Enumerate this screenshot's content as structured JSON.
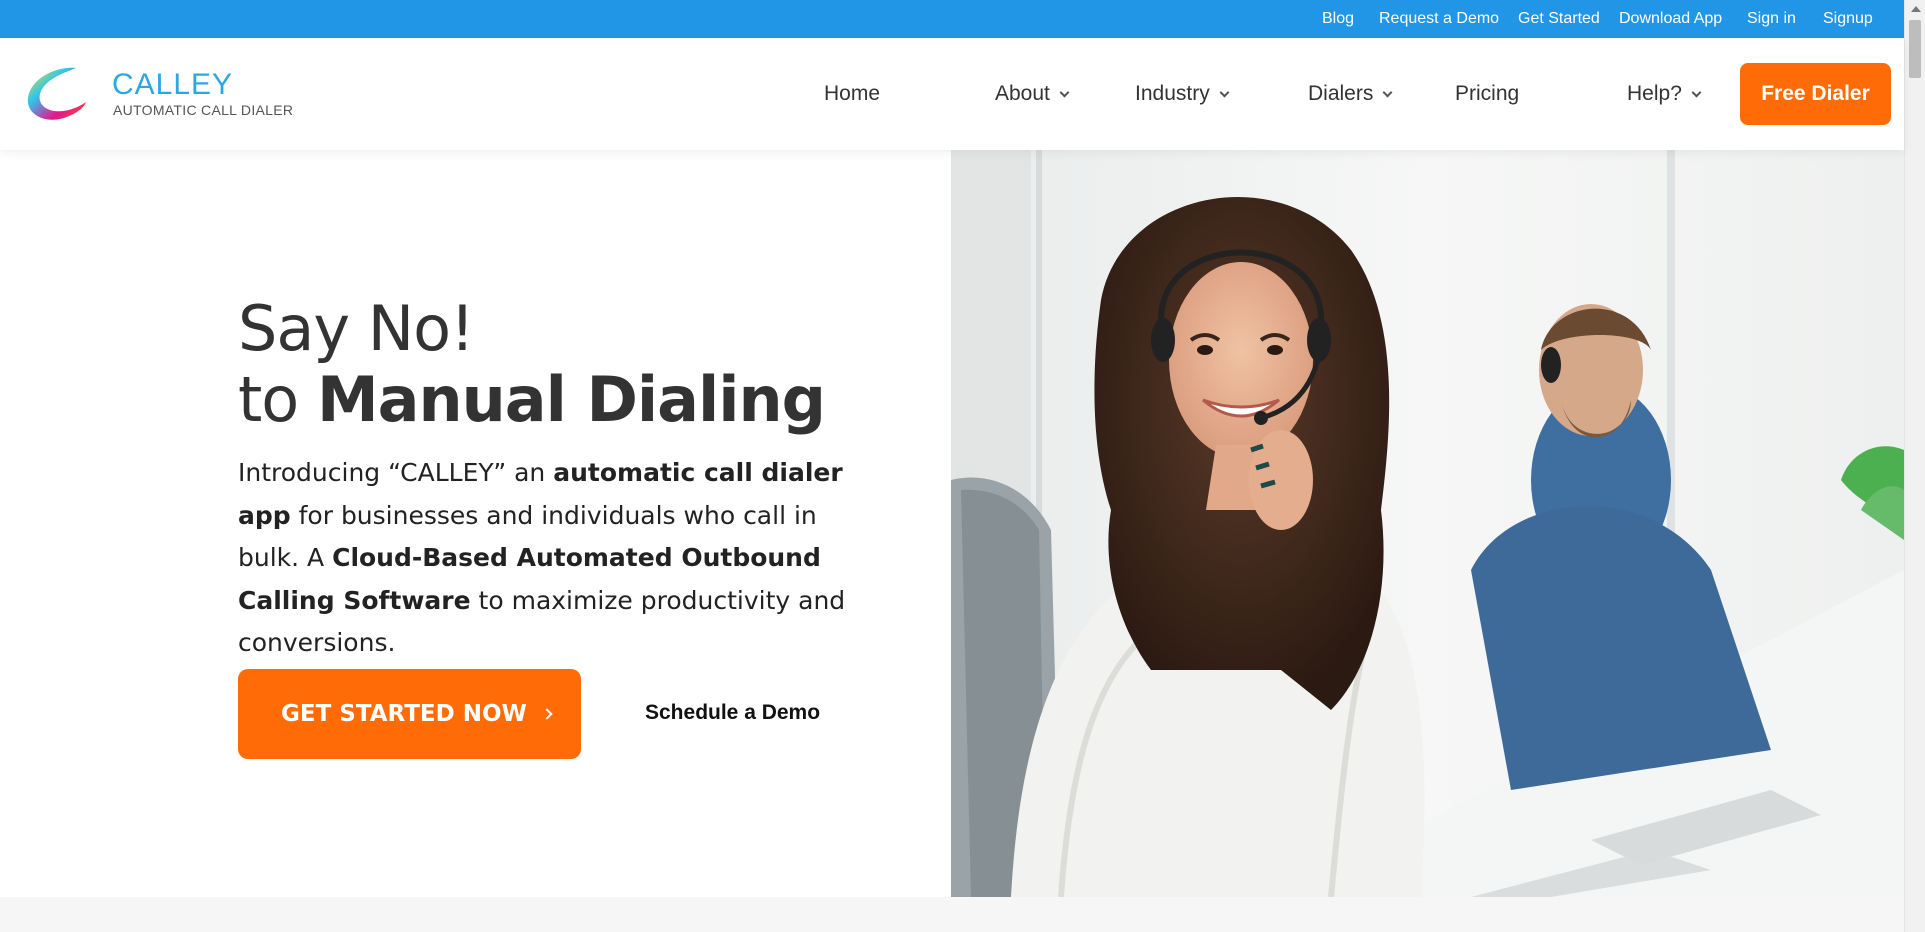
{
  "topbar": {
    "links": [
      {
        "label": "Blog"
      },
      {
        "label": "Request a Demo"
      },
      {
        "label": "Get Started"
      },
      {
        "label": "Download App"
      },
      {
        "label": "Sign in"
      },
      {
        "label": "Signup"
      }
    ]
  },
  "brand": {
    "name": "CALLEY",
    "tagline": "AUTOMATIC CALL DIALER"
  },
  "nav": {
    "items": [
      {
        "label": "Home"
      },
      {
        "label": "About"
      },
      {
        "label": "Industry"
      },
      {
        "label": "Dialers"
      },
      {
        "label": "Pricing"
      },
      {
        "label": "Help?"
      }
    ],
    "cta_label": "Free Dialer"
  },
  "hero": {
    "heading_line1": "Say No!",
    "heading_line2_prefix": "to ",
    "heading_line2_bold": "Manual Dialing",
    "intro_1": "Introducing “CALLEY” an ",
    "intro_bold_1": "automatic call dialer app",
    "intro_2": " for businesses and individuals who call in bulk. A ",
    "intro_bold_2": "Cloud-Based Automated Outbound Calling Software",
    "intro_3": " to maximize productivity and conversions.",
    "cta_label": "GET STARTED NOW",
    "secondary_label": "Schedule a Demo"
  },
  "colors": {
    "topbar": "#2196e6",
    "accent_orange": "#ff6b06",
    "brand_blue": "#2ea6e6",
    "text_dark": "#333333"
  },
  "icons": {
    "logo": "calley-swirl-logo",
    "dropdown": "chevron-down-icon",
    "cta_arrow": "chevron-right-icon"
  }
}
